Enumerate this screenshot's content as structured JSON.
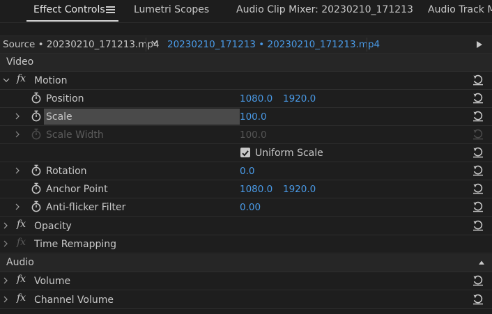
{
  "tabs": [
    {
      "label": "Effect Controls"
    },
    {
      "label": "Lumetri Scopes"
    },
    {
      "label": "Audio Clip Mixer: 20230210_171213"
    },
    {
      "label": "Audio Track Mi"
    }
  ],
  "source_bar": {
    "source": "Source • 20230210_171213.mp4",
    "sequence": "20230210_171213 • 20230210_171213.mp4"
  },
  "sections": {
    "video": "Video",
    "audio": "Audio"
  },
  "effects": {
    "motion": "Motion",
    "opacity": "Opacity",
    "time_remapping": "Time Remapping",
    "volume": "Volume",
    "channel_volume": "Channel Volume"
  },
  "properties": {
    "position": {
      "label": "Position",
      "x": "1080.0",
      "y": "1920.0"
    },
    "scale": {
      "label": "Scale",
      "value": "100.0"
    },
    "scale_width": {
      "label": "Scale Width",
      "value": "100.0"
    },
    "uniform_scale": {
      "label": "Uniform Scale",
      "checked": true
    },
    "rotation": {
      "label": "Rotation",
      "value": "0.0"
    },
    "anchor_point": {
      "label": "Anchor Point",
      "x": "1080.0",
      "y": "1920.0"
    },
    "anti_flicker": {
      "label": "Anti-flicker Filter",
      "value": "0.00"
    }
  },
  "colors": {
    "accent_value": "#4a9be8",
    "panel_bg": "#1e1e1e",
    "section_bg": "#262626"
  },
  "icons": [
    "menu-icon",
    "chevron-down-icon",
    "play-icon",
    "caret-right-icon",
    "caret-down-icon",
    "fx-icon",
    "stopwatch-icon",
    "reset-icon",
    "checkmark-icon",
    "collapse-up-icon"
  ]
}
